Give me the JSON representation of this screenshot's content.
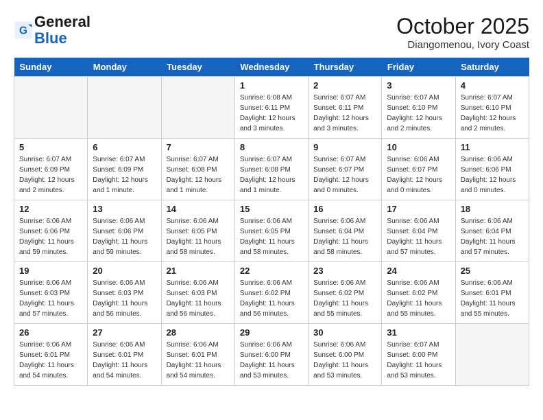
{
  "header": {
    "logo_line1": "General",
    "logo_line2": "Blue",
    "month": "October 2025",
    "location": "Diangomenou, Ivory Coast"
  },
  "days_of_week": [
    "Sunday",
    "Monday",
    "Tuesday",
    "Wednesday",
    "Thursday",
    "Friday",
    "Saturday"
  ],
  "weeks": [
    [
      {
        "num": "",
        "info": ""
      },
      {
        "num": "",
        "info": ""
      },
      {
        "num": "",
        "info": ""
      },
      {
        "num": "1",
        "info": "Sunrise: 6:08 AM\nSunset: 6:11 PM\nDaylight: 12 hours and 3 minutes."
      },
      {
        "num": "2",
        "info": "Sunrise: 6:07 AM\nSunset: 6:11 PM\nDaylight: 12 hours and 3 minutes."
      },
      {
        "num": "3",
        "info": "Sunrise: 6:07 AM\nSunset: 6:10 PM\nDaylight: 12 hours and 2 minutes."
      },
      {
        "num": "4",
        "info": "Sunrise: 6:07 AM\nSunset: 6:10 PM\nDaylight: 12 hours and 2 minutes."
      }
    ],
    [
      {
        "num": "5",
        "info": "Sunrise: 6:07 AM\nSunset: 6:09 PM\nDaylight: 12 hours and 2 minutes."
      },
      {
        "num": "6",
        "info": "Sunrise: 6:07 AM\nSunset: 6:09 PM\nDaylight: 12 hours and 1 minute."
      },
      {
        "num": "7",
        "info": "Sunrise: 6:07 AM\nSunset: 6:08 PM\nDaylight: 12 hours and 1 minute."
      },
      {
        "num": "8",
        "info": "Sunrise: 6:07 AM\nSunset: 6:08 PM\nDaylight: 12 hours and 1 minute."
      },
      {
        "num": "9",
        "info": "Sunrise: 6:07 AM\nSunset: 6:07 PM\nDaylight: 12 hours and 0 minutes."
      },
      {
        "num": "10",
        "info": "Sunrise: 6:06 AM\nSunset: 6:07 PM\nDaylight: 12 hours and 0 minutes."
      },
      {
        "num": "11",
        "info": "Sunrise: 6:06 AM\nSunset: 6:06 PM\nDaylight: 12 hours and 0 minutes."
      }
    ],
    [
      {
        "num": "12",
        "info": "Sunrise: 6:06 AM\nSunset: 6:06 PM\nDaylight: 11 hours and 59 minutes."
      },
      {
        "num": "13",
        "info": "Sunrise: 6:06 AM\nSunset: 6:06 PM\nDaylight: 11 hours and 59 minutes."
      },
      {
        "num": "14",
        "info": "Sunrise: 6:06 AM\nSunset: 6:05 PM\nDaylight: 11 hours and 58 minutes."
      },
      {
        "num": "15",
        "info": "Sunrise: 6:06 AM\nSunset: 6:05 PM\nDaylight: 11 hours and 58 minutes."
      },
      {
        "num": "16",
        "info": "Sunrise: 6:06 AM\nSunset: 6:04 PM\nDaylight: 11 hours and 58 minutes."
      },
      {
        "num": "17",
        "info": "Sunrise: 6:06 AM\nSunset: 6:04 PM\nDaylight: 11 hours and 57 minutes."
      },
      {
        "num": "18",
        "info": "Sunrise: 6:06 AM\nSunset: 6:04 PM\nDaylight: 11 hours and 57 minutes."
      }
    ],
    [
      {
        "num": "19",
        "info": "Sunrise: 6:06 AM\nSunset: 6:03 PM\nDaylight: 11 hours and 57 minutes."
      },
      {
        "num": "20",
        "info": "Sunrise: 6:06 AM\nSunset: 6:03 PM\nDaylight: 11 hours and 56 minutes."
      },
      {
        "num": "21",
        "info": "Sunrise: 6:06 AM\nSunset: 6:03 PM\nDaylight: 11 hours and 56 minutes."
      },
      {
        "num": "22",
        "info": "Sunrise: 6:06 AM\nSunset: 6:02 PM\nDaylight: 11 hours and 56 minutes."
      },
      {
        "num": "23",
        "info": "Sunrise: 6:06 AM\nSunset: 6:02 PM\nDaylight: 11 hours and 55 minutes."
      },
      {
        "num": "24",
        "info": "Sunrise: 6:06 AM\nSunset: 6:02 PM\nDaylight: 11 hours and 55 minutes."
      },
      {
        "num": "25",
        "info": "Sunrise: 6:06 AM\nSunset: 6:01 PM\nDaylight: 11 hours and 55 minutes."
      }
    ],
    [
      {
        "num": "26",
        "info": "Sunrise: 6:06 AM\nSunset: 6:01 PM\nDaylight: 11 hours and 54 minutes."
      },
      {
        "num": "27",
        "info": "Sunrise: 6:06 AM\nSunset: 6:01 PM\nDaylight: 11 hours and 54 minutes."
      },
      {
        "num": "28",
        "info": "Sunrise: 6:06 AM\nSunset: 6:01 PM\nDaylight: 11 hours and 54 minutes."
      },
      {
        "num": "29",
        "info": "Sunrise: 6:06 AM\nSunset: 6:00 PM\nDaylight: 11 hours and 53 minutes."
      },
      {
        "num": "30",
        "info": "Sunrise: 6:06 AM\nSunset: 6:00 PM\nDaylight: 11 hours and 53 minutes."
      },
      {
        "num": "31",
        "info": "Sunrise: 6:07 AM\nSunset: 6:00 PM\nDaylight: 11 hours and 53 minutes."
      },
      {
        "num": "",
        "info": ""
      }
    ]
  ]
}
